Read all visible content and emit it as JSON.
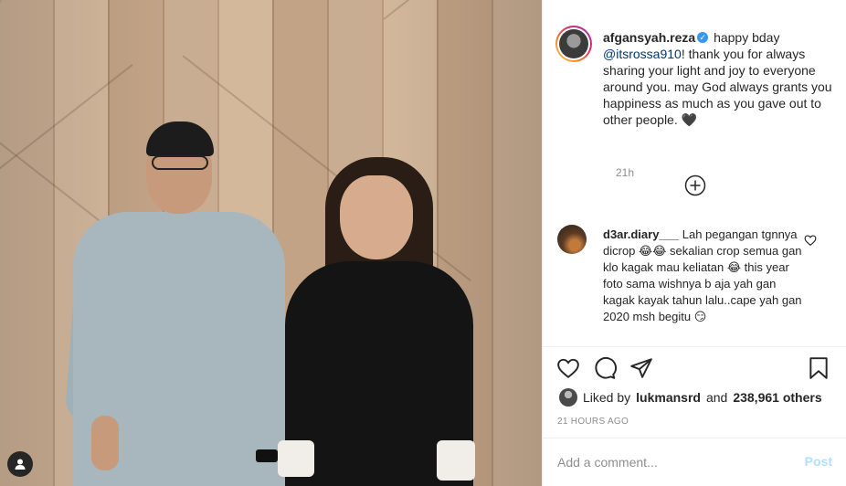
{
  "post": {
    "author": "afgansyah.reza",
    "verified": true,
    "caption_prefix": "happy bday",
    "caption_mention": "@itsrossa910",
    "caption_rest": "! thank you for always sharing your light and joy to everyone around you. may God always grants you happiness as much as you gave out to other people. 🖤",
    "caption_time": "21h"
  },
  "load_more_icon": "plus-circle-icon",
  "comments": [
    {
      "username": "d3ar.diary___",
      "text": "Lah pegangan tgnnya dicrop 😂😂 sekalian crop semua gan klo kagak mau keliatan 😂 this year foto sama wishnya b aja yah gan kagak kayak tahun lalu..cape yah gan 2020 msh begitu 😏"
    }
  ],
  "actions": {
    "like_icon": "heart-icon",
    "comment_icon": "comment-icon",
    "share_icon": "paper-plane-icon",
    "save_icon": "bookmark-icon"
  },
  "likes": {
    "prefix": "Liked by",
    "user": "lukmansrd",
    "and": "and",
    "count": "238,961 others"
  },
  "posted_ago": "21 HOURS AGO",
  "comment_input": {
    "placeholder": "Add a comment...",
    "post_label": "Post"
  },
  "colors": {
    "link": "#00376b",
    "verified": "#3897f0",
    "post_button_disabled": "#b2dffc",
    "muted": "#8e8e8e"
  }
}
